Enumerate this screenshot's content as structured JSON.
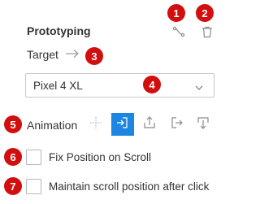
{
  "panel": {
    "title": "Prototyping",
    "target_label": "Target",
    "device_select": {
      "value": "Pixel 4 XL"
    },
    "animation_label": "Animation",
    "animation_options": [
      {
        "icon": "none-icon",
        "active": false
      },
      {
        "icon": "slide-in-left-icon",
        "active": true
      },
      {
        "icon": "slide-in-up-icon",
        "active": false
      },
      {
        "icon": "slide-in-right-icon",
        "active": false
      },
      {
        "icon": "slide-in-down-icon",
        "active": false
      }
    ],
    "checkboxes": [
      {
        "label": "Fix Position on Scroll",
        "checked": false
      },
      {
        "label": "Maintain scroll position after click",
        "checked": false
      }
    ]
  },
  "annotations": [
    "1",
    "2",
    "3",
    "4",
    "5",
    "6",
    "7"
  ],
  "colors": {
    "accent": "#1d86e0",
    "badge": "#d10f0f",
    "icon": "#8a8a8a"
  }
}
